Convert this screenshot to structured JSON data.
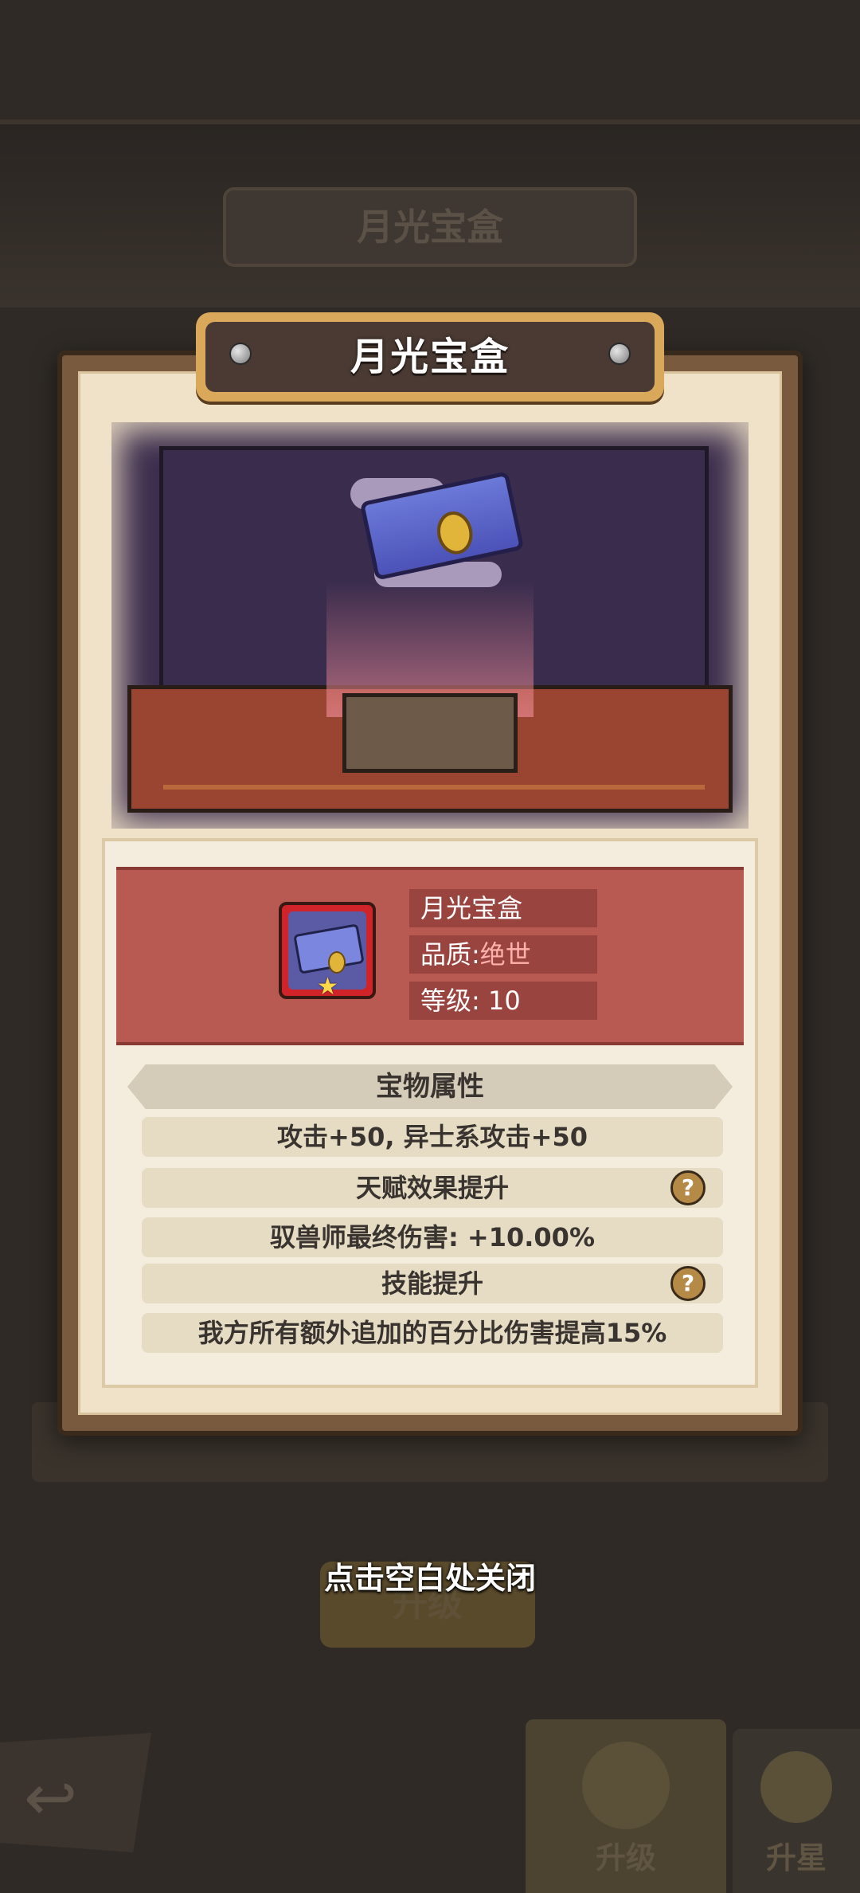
{
  "background": {
    "title_ghost": "月光宝盒",
    "old_button_label": "升级",
    "tabs": [
      {
        "label": "升级"
      },
      {
        "label": "升星"
      }
    ]
  },
  "dialog": {
    "title": "月光宝盒",
    "item": {
      "name": "月光宝盒",
      "quality_label": "品质:",
      "quality_value": "绝世",
      "level_label": "等级:",
      "level_value": "10",
      "icon": "moonlight-box-icon"
    },
    "section_title": "宝物属性",
    "stats": [
      {
        "text": "攻击+50, 异士系攻击+50",
        "help": false
      },
      {
        "text": "天赋效果提升",
        "help": true
      },
      {
        "text": "驭兽师最终伤害: +10.00%",
        "help": false
      },
      {
        "text": "技能提升",
        "help": true
      },
      {
        "text": "我方所有额外追加的百分比伤害提高15%",
        "help": false
      }
    ],
    "help_glyph": "?"
  },
  "close_hint": "点击空白处关闭",
  "colors": {
    "banner": "#b85a52",
    "quality_text": "#ffb3a8",
    "title_plate": "#4a3a33"
  }
}
